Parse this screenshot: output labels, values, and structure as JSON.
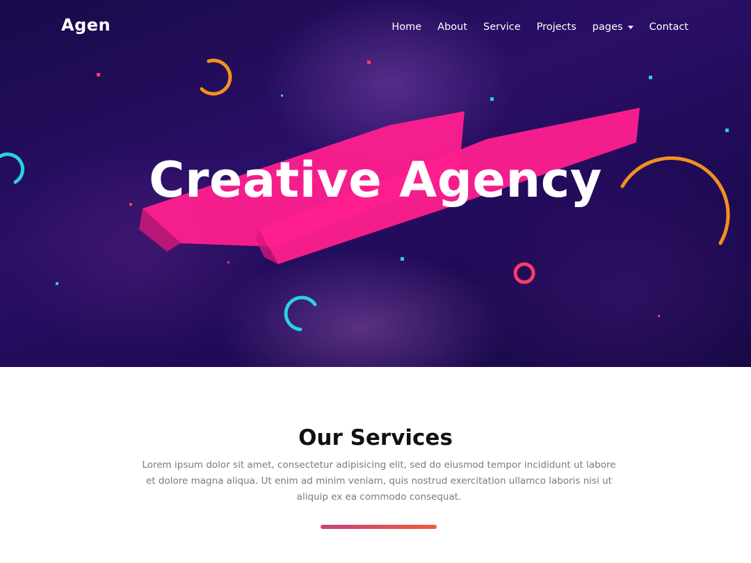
{
  "header": {
    "brand": "Agen",
    "nav": [
      {
        "label": "Home"
      },
      {
        "label": "About"
      },
      {
        "label": "Service"
      },
      {
        "label": "Projects"
      },
      {
        "label": "pages",
        "has_dropdown": true
      },
      {
        "label": "Contact"
      }
    ]
  },
  "hero": {
    "title": "Creative Agency",
    "colors": {
      "brush": "#ff1f8e",
      "ring_orange": "#f5901e",
      "ring_cyan": "#2ad0e6",
      "ring_pink": "#ff3a6a"
    }
  },
  "services": {
    "title": "Our Services",
    "description": "Lorem ipsum dolor sit amet, consectetur adipisicing elit, sed do eiusmod tempor incididunt ut labore et dolore magna aliqua. Ut enim ad minim veniam, quis nostrud exercitation ullamco laboris nisi ut aliquip ex ea commodo consequat.",
    "accent_gradient": [
      "#c8427a",
      "#f05a3c"
    ]
  }
}
